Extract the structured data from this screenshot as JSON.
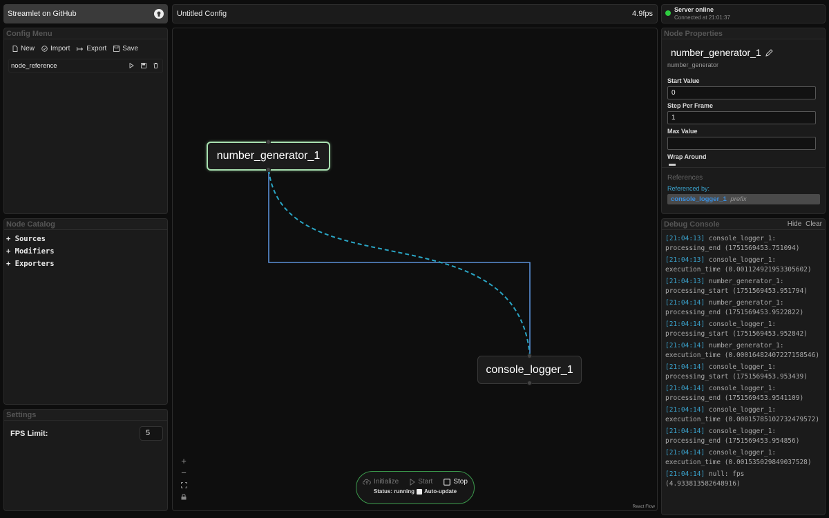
{
  "github": {
    "label": "Streamlet on GitHub"
  },
  "header": {
    "title": "Untitled Config",
    "fps": "4.9fps"
  },
  "server": {
    "status": "Server online",
    "connected": "Connected at 21:01:37",
    "status_color": "#2ecc40"
  },
  "config_menu": {
    "title": "Config Menu",
    "buttons": {
      "new": "New",
      "import": "Import",
      "export": "Export",
      "save": "Save"
    },
    "items": [
      {
        "name": "node_reference"
      }
    ]
  },
  "catalog": {
    "title": "Node Catalog",
    "items": [
      "+ Sources",
      "+ Modifiers",
      "+ Exporters"
    ]
  },
  "settings": {
    "title": "Settings",
    "fps_label": "FPS Limit:",
    "fps_value": "5"
  },
  "canvas": {
    "nodes": {
      "generator": "number_generator_1",
      "logger": "console_logger_1"
    },
    "zoom_in": "+",
    "zoom_out": "−",
    "attribution": "React Flow"
  },
  "controls": {
    "initialize": "Initialize",
    "start": "Start",
    "stop": "Stop",
    "status": "Status: running",
    "auto_update": "Auto-update"
  },
  "properties": {
    "title": "Node Properties",
    "node_name": "number_generator_1",
    "node_type": "number_generator",
    "fields": [
      {
        "label": "Start Value",
        "value": "0"
      },
      {
        "label": "Step Per Frame",
        "value": "1"
      },
      {
        "label": "Max Value",
        "value": ""
      }
    ],
    "wrap_label": "Wrap Around",
    "references_title": "References",
    "referenced_by": "Referenced by:",
    "ref_node": "console_logger_1",
    "ref_kind": "prefix"
  },
  "debug": {
    "title": "Debug Console",
    "hide": "Hide",
    "clear": "Clear",
    "logs": [
      {
        "ts": "[21:04:13]",
        "msg": " console_logger_1: processing_end (1751569453.751094)"
      },
      {
        "ts": "[21:04:13]",
        "msg": " console_logger_1: execution_time (0.001124921953305602)"
      },
      {
        "ts": "[21:04:13]",
        "msg": " number_generator_1: processing_start (1751569453.951794)"
      },
      {
        "ts": "[21:04:14]",
        "msg": " number_generator_1: processing_end (1751569453.9522822)"
      },
      {
        "ts": "[21:04:14]",
        "msg": " console_logger_1: processing_start (1751569453.952842)"
      },
      {
        "ts": "[21:04:14]",
        "msg": " number_generator_1: execution_time (0.00016482407227158546)"
      },
      {
        "ts": "[21:04:14]",
        "msg": " console_logger_1: processing_start (1751569453.953439)"
      },
      {
        "ts": "[21:04:14]",
        "msg": " console_logger_1: processing_end (1751569453.9541109)"
      },
      {
        "ts": "[21:04:14]",
        "msg": " console_logger_1: execution_time (0.00015785102732479572)"
      },
      {
        "ts": "[21:04:14]",
        "msg": " console_logger_1: processing_end (1751569453.954856)"
      },
      {
        "ts": "[21:04:14]",
        "msg": " console_logger_1: execution_time (0.001535029849037528)"
      },
      {
        "ts": "[21:04:14]",
        "msg": " null: fps (4.933813582648916)"
      }
    ]
  }
}
